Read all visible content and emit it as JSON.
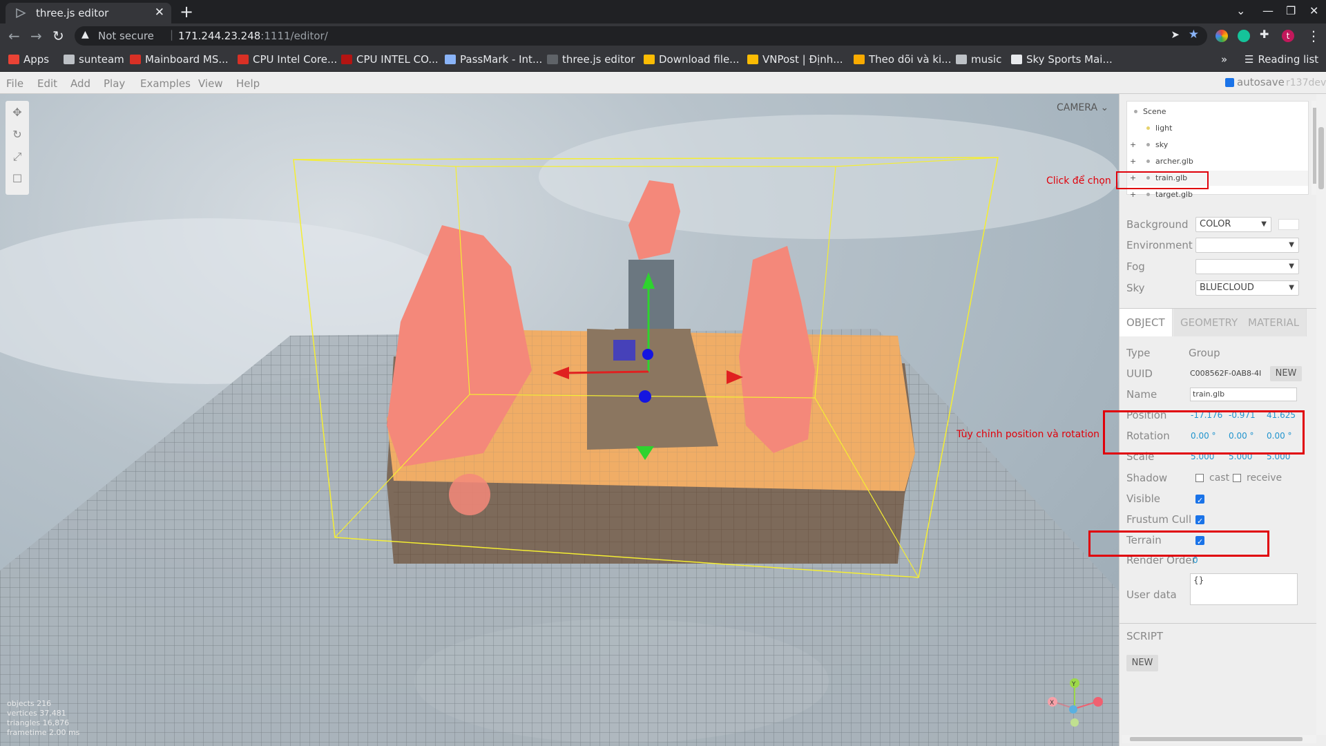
{
  "browser": {
    "tab_title": "three.js editor",
    "tab_close": "✕",
    "new_tab": "+",
    "not_secure": "Not secure",
    "url_host": "171.244.23.248",
    "url_rest": ":1111/editor/",
    "bookmarks": [
      {
        "label": "Apps",
        "color": "#ea4335"
      },
      {
        "label": "sunteam",
        "color": "#bdc1c6"
      },
      {
        "label": "Mainboard MS...",
        "color": "#d93025"
      },
      {
        "label": "CPU Intel Core...",
        "color": "#d93025"
      },
      {
        "label": "CPU INTEL CO...",
        "color": "#b31412"
      },
      {
        "label": "PassMark - Int...",
        "color": "#8ab4f8"
      },
      {
        "label": "three.js editor",
        "color": "#5f6368"
      },
      {
        "label": "Download file...",
        "color": "#fbbc04"
      },
      {
        "label": "VNPost | Định...",
        "color": "#fbbc04"
      },
      {
        "label": "Theo dõi và ki...",
        "color": "#f9ab00"
      },
      {
        "label": "music",
        "color": "#bdc1c6"
      },
      {
        "label": "Sky Sports Mai...",
        "color": "#e8eaed"
      }
    ],
    "overflow": "»",
    "reading_list": "Reading list"
  },
  "menubar": {
    "items": [
      "File",
      "Edit",
      "Add",
      "Play",
      "Examples",
      "View",
      "Help"
    ],
    "autosave": "autosave",
    "version": "r137dev"
  },
  "viewport": {
    "camera": "CAMERA",
    "info": [
      "objects 216",
      "vertices 37,481",
      "triangles 16,876",
      "frametime 2.00 ms"
    ],
    "axes": {
      "y": "Y",
      "x": "X"
    }
  },
  "outliner": {
    "items": [
      {
        "label": "Scene",
        "expandable": false,
        "dot": "#aaa"
      },
      {
        "label": "light",
        "expandable": false,
        "dot": "#e6d26b"
      },
      {
        "label": "sky",
        "expandable": true,
        "dot": "#aaa"
      },
      {
        "label": "archer.glb",
        "expandable": true,
        "dot": "#aaa"
      },
      {
        "label": "train.glb",
        "expandable": true,
        "dot": "#aaa",
        "selected": true
      },
      {
        "label": "target.glb",
        "expandable": true,
        "dot": "#aaa"
      }
    ]
  },
  "scene_props": {
    "background_label": "Background",
    "background_value": "COLOR",
    "environment_label": "Environment",
    "environment_value": "",
    "fog_label": "Fog",
    "fog_value": "",
    "sky_label": "Sky",
    "sky_value": "BLUECLOUD"
  },
  "tabs": [
    "OBJECT",
    "GEOMETRY",
    "MATERIAL"
  ],
  "object": {
    "type_label": "Type",
    "type_value": "Group",
    "uuid_label": "UUID",
    "uuid_value": "C008562F-0AB8-4I",
    "uuid_button": "NEW",
    "name_label": "Name",
    "name_value": "train.glb",
    "position_label": "Position",
    "position": [
      "-17.176",
      "-0.971",
      "41.625"
    ],
    "rotation_label": "Rotation",
    "rotation": [
      "0.00 °",
      "0.00 °",
      "0.00 °"
    ],
    "scale_label": "Scale",
    "scale": [
      "5.000",
      "5.000",
      "5.000"
    ],
    "shadow_label": "Shadow",
    "cast_label": "cast",
    "receive_label": "receive",
    "visible_label": "Visible",
    "frustum_label": "Frustum Cull",
    "terrain_label": "Terrain",
    "render_order_label": "Render Order",
    "render_order_value": "0",
    "userdata_label": "User data",
    "userdata_value": "{}"
  },
  "script": {
    "title": "SCRIPT",
    "new_button": "NEW"
  },
  "annotations": {
    "click_to_select": "Click để chọn",
    "adjust_pos_rot": "Tùy chỉnh position và rotation"
  }
}
